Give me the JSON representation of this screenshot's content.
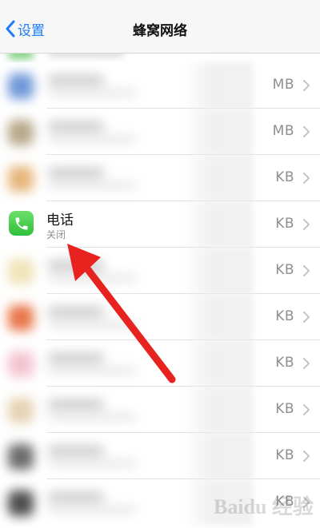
{
  "nav": {
    "back_label": "设置",
    "title": "蜂窝网络"
  },
  "rows": [
    {
      "size": "MB",
      "icon_color": "#6f97d8"
    },
    {
      "size": "MB",
      "icon_color": "#b8a88a"
    },
    {
      "size": "KB",
      "icon_color": "#e8b67a"
    },
    {
      "size": "KB",
      "title": "电话",
      "subtitle": "关闭",
      "icon": "phone-icon",
      "icon_color": "#4cd964"
    },
    {
      "size": "KB",
      "icon_color": "#efe3b6"
    },
    {
      "size": "KB",
      "icon_color": "#e9764a"
    },
    {
      "size": "KB",
      "icon_color": "#f3c3d0"
    },
    {
      "size": "KB",
      "icon_color": "#e7d2b4"
    },
    {
      "size": "KB",
      "icon_color": "#6b6b6b"
    },
    {
      "size": "KB",
      "icon_color": "#4d4d4d"
    }
  ],
  "annotation": {
    "arrow_color": "#e8231f"
  },
  "watermark": {
    "text": "Baidu 经验"
  }
}
